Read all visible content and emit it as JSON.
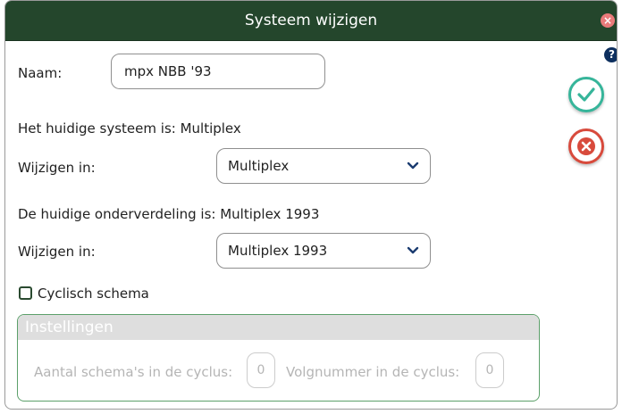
{
  "dialog": {
    "title": "Systeem wijzigen",
    "close_icon": "close-icon",
    "help_icon": "help-icon",
    "help_glyph": "?",
    "close_glyph": "×"
  },
  "form": {
    "name_label": "Naam:",
    "name_value": "mpx NBB '93",
    "current_system_text": "Het huidige systeem is: Multiplex",
    "change_to_label_1": "Wijzigen in:",
    "system_select_value": "Multiplex",
    "current_subdivision_text": "De huidige onderverdeling is: Multiplex 1993",
    "change_to_label_2": "Wijzigen in:",
    "subdivision_select_value": "Multiplex 1993",
    "cyclic_checkbox_label": "Cyclisch schema",
    "cyclic_checked": false
  },
  "settings": {
    "header": "Instellingen",
    "cycle_count_label": "Aantal schema's in de cyclus:",
    "cycle_count_value": "0",
    "cycle_number_label": "Volgnummer in de cyclus:",
    "cycle_number_value": "0"
  },
  "actions": {
    "ok_icon": "check-icon",
    "cancel_icon": "cancel-icon"
  },
  "colors": {
    "titlebar": "#24462c",
    "ok_accent": "#36b59a",
    "cancel_accent": "#d84a3c",
    "fieldset_border": "#5ca06a",
    "chevron": "#1b3c70"
  }
}
